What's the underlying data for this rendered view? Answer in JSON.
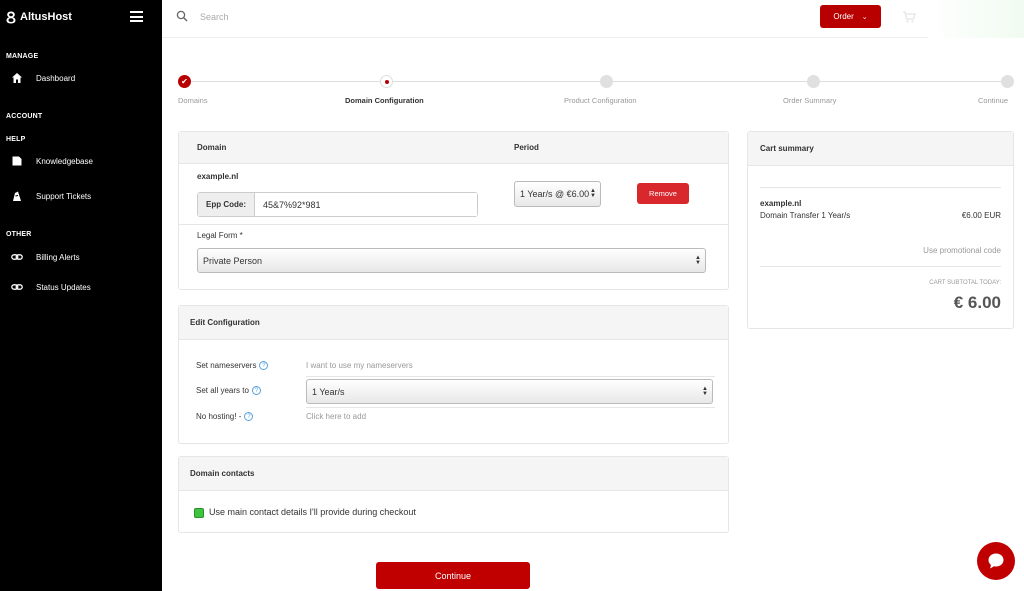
{
  "brand": {
    "name": "AltusHost"
  },
  "sidebar": {
    "sections": [
      {
        "title": "MANAGE"
      },
      {
        "title": "ACCOUNT"
      },
      {
        "title": "HELP"
      },
      {
        "title": "OTHER"
      }
    ],
    "items": [
      {
        "label": "Dashboard",
        "icon": "home-icon"
      },
      {
        "label": "Knowledgebase",
        "icon": "book-icon"
      },
      {
        "label": "Support Tickets",
        "icon": "ticket-icon"
      },
      {
        "label": "Billing Alerts",
        "icon": "link-icon"
      },
      {
        "label": "Status Updates",
        "icon": "link-icon"
      }
    ]
  },
  "topbar": {
    "search_placeholder": "Search",
    "order_label": "Order"
  },
  "steps": [
    {
      "label": "Domains",
      "state": "done"
    },
    {
      "label": "Domain Configuration",
      "state": "current"
    },
    {
      "label": "Product Configuration",
      "state": "pending"
    },
    {
      "label": "Order Summary",
      "state": "pending"
    },
    {
      "label": "Continue",
      "state": "pending"
    }
  ],
  "domain_panel": {
    "col_domain": "Domain",
    "col_period": "Period",
    "domain_name": "example.nl",
    "epp_label": "Epp Code:",
    "epp_value": "45&7%92*981",
    "period_value": "1 Year/s @ €6.00",
    "remove_label": "Remove",
    "legal_form_label": "Legal Form *",
    "legal_form_value": "Private Person"
  },
  "edit_config": {
    "title": "Edit Configuration",
    "nameservers_label": "Set nameservers",
    "nameservers_value": "I want to use my nameservers",
    "all_years_label": "Set all years to",
    "all_years_value": "1 Year/s",
    "hosting_label": "No hosting! -",
    "hosting_value": "Click here to add",
    "help_glyph": "?"
  },
  "domain_contacts": {
    "title": "Domain contacts",
    "checkbox_label": "Use main contact details I'll provide during checkout",
    "checked": true
  },
  "cart": {
    "title": "Cart summary",
    "item_name": "example.nl",
    "item_desc": "Domain Transfer 1 Year/s",
    "item_price": "€6.00 EUR",
    "promo_label": "Use promotional code",
    "subtotal_label": "CART SUBTOTAL TODAY:",
    "subtotal_value": "€ 6.00"
  },
  "continue_label": "Continue",
  "colors": {
    "accent": "#b80000",
    "sidebar": "#000000"
  }
}
